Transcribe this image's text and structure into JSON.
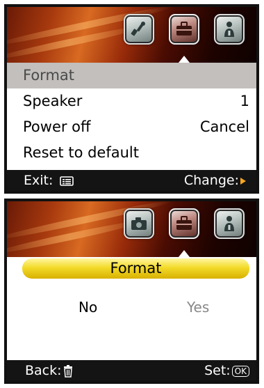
{
  "screen1": {
    "tabs": [
      {
        "icon": "tools-icon",
        "active": false
      },
      {
        "icon": "toolbox-icon",
        "active": true
      },
      {
        "icon": "info-icon",
        "active": false
      }
    ],
    "menu": [
      {
        "label": "Format",
        "value": "",
        "selected": true
      },
      {
        "label": "Speaker",
        "value": "1",
        "selected": false
      },
      {
        "label": "Power off",
        "value": "Cancel",
        "selected": false
      },
      {
        "label": "Reset to default",
        "value": "",
        "selected": false
      }
    ],
    "footer": {
      "exit_label": "Exit:",
      "exit_icon": "menu-icon",
      "change_label": "Change:",
      "change_icon": "right-arrow-icon"
    }
  },
  "screen2": {
    "tabs": [
      {
        "icon": "camera-icon",
        "active": false
      },
      {
        "icon": "toolbox-icon",
        "active": true
      },
      {
        "icon": "info-icon",
        "active": false
      }
    ],
    "dialog": {
      "title": "Format",
      "options": [
        "No",
        "Yes"
      ],
      "selected": "No"
    },
    "footer": {
      "back_label": "Back:",
      "back_icon": "trash-icon",
      "set_label": "Set:",
      "set_badge": "OK"
    }
  },
  "colors": {
    "highlight": "#c2bfbc",
    "dialog_bar": "#f3db2a",
    "footer_bg": "#141414",
    "arrow": "#f5a623"
  }
}
